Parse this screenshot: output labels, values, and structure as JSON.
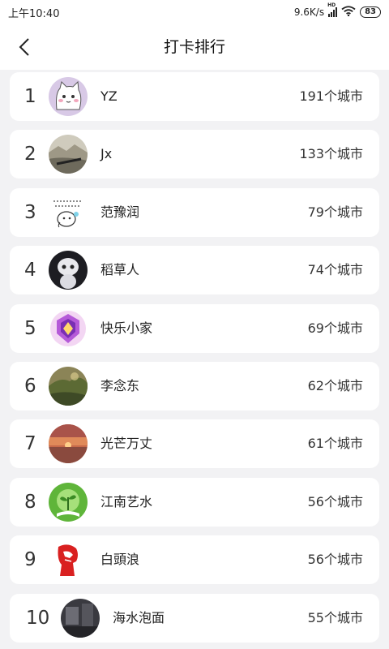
{
  "status": {
    "time": "上午10:40",
    "net_speed": "9.6K/s",
    "network_badge": "HD",
    "battery": "83"
  },
  "header": {
    "title": "打卡排行",
    "back_icon": "chevron-left-icon"
  },
  "ranking": [
    {
      "rank": "1",
      "name": "YZ",
      "count": "191个城市",
      "avatar_icon": "cat-cartoon-avatar"
    },
    {
      "rank": "2",
      "name": "Jx",
      "count": "133个城市",
      "avatar_icon": "mountain-landscape-avatar"
    },
    {
      "rank": "3",
      "name": "范豫润",
      "count": "79个城市",
      "avatar_icon": "handwritten-doodle-avatar"
    },
    {
      "rank": "4",
      "name": "稻草人",
      "count": "74个城市",
      "avatar_icon": "robot-avatar"
    },
    {
      "rank": "5",
      "name": "快乐小家",
      "count": "69个城市",
      "avatar_icon": "game-badge-avatar"
    },
    {
      "rank": "6",
      "name": "李念东",
      "count": "62个城市",
      "avatar_icon": "forest-landscape-avatar"
    },
    {
      "rank": "7",
      "name": "光芒万丈",
      "count": "61个城市",
      "avatar_icon": "sunset-avatar"
    },
    {
      "rank": "8",
      "name": "江南艺水",
      "count": "56个城市",
      "avatar_icon": "sprout-book-avatar"
    },
    {
      "rank": "9",
      "name": "白頭浪",
      "count": "56个城市",
      "avatar_icon": "red-portrait-avatar"
    },
    {
      "rank": "10",
      "name": "海水泡面",
      "count": "55个城市",
      "avatar_icon": "dark-photo-avatar"
    }
  ]
}
